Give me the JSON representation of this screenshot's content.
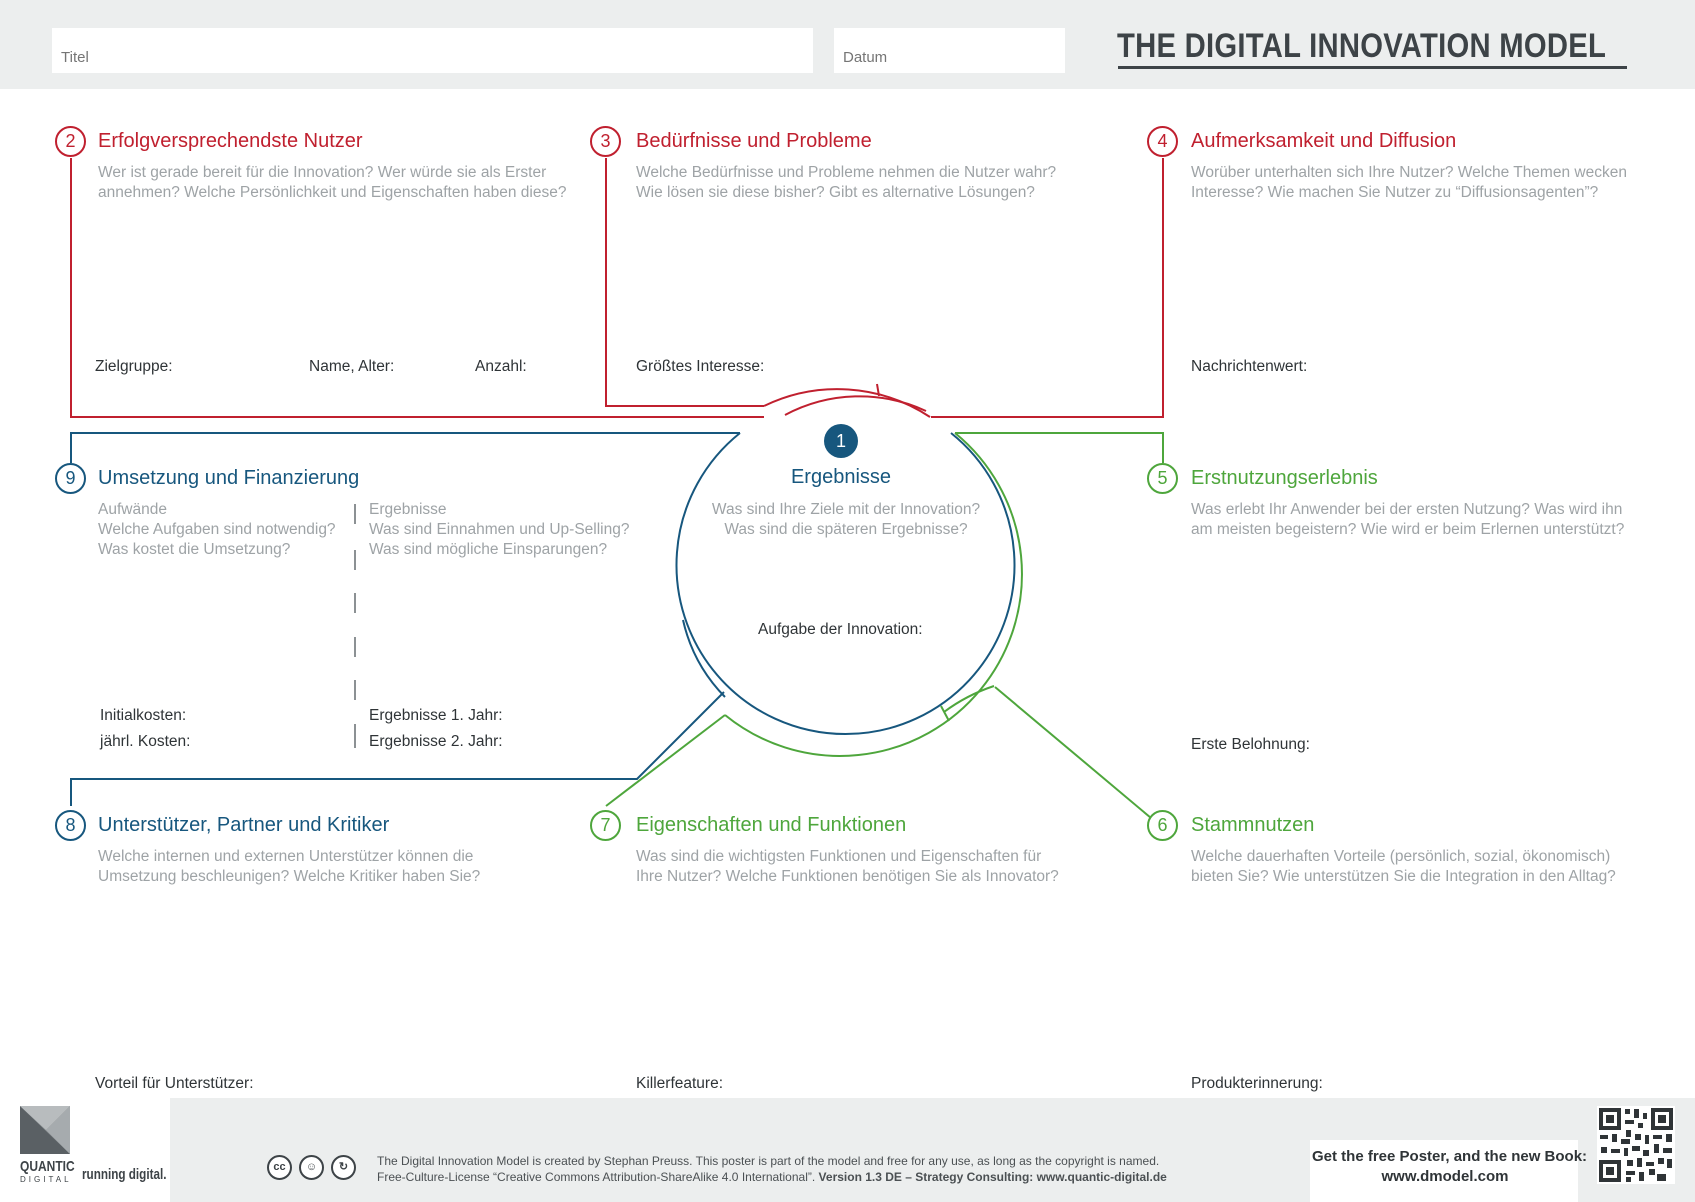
{
  "header": {
    "title_placeholder": "Titel",
    "date_placeholder": "Datum",
    "model_title": "THE DIGITAL INNOVATION MODEL"
  },
  "colors": {
    "red": "#c0202f",
    "blue": "#17577e",
    "green": "#4ea63c",
    "dark": "#3d4347",
    "grey_text": "#9ea3a6"
  },
  "center": {
    "number": "1",
    "title": "Ergebnisse",
    "question": "Was sind Ihre Ziele mit der Innovation?\nWas sind die späteren Ergebnisse?",
    "label": "Aufgabe der Innovation:"
  },
  "sections": {
    "s2": {
      "number": "2",
      "title": "Erfolgversprechendste Nutzer",
      "question": "Wer ist gerade bereit für die Innovation? Wer würde sie als Erster\nannehmen? Welche Persönlichkeit und Eigenschaften haben diese?",
      "labels": [
        "Zielgruppe:",
        "Name, Alter:",
        "Anzahl:"
      ]
    },
    "s3": {
      "number": "3",
      "title": "Bedürfnisse und Probleme",
      "question": "Welche Bedürfnisse und Probleme nehmen die Nutzer wahr?\nWie lösen sie diese bisher? Gibt es alternative Lösungen?",
      "labels": [
        "Größtes Interesse:"
      ]
    },
    "s4": {
      "number": "4",
      "title": "Aufmerksamkeit und Diffusion",
      "question": "Worüber unterhalten sich Ihre Nutzer? Welche Themen wecken\nInteresse? Wie machen Sie Nutzer zu “Diffusionsagenten”?",
      "labels": [
        "Nachrichtenwert:"
      ]
    },
    "s5": {
      "number": "5",
      "title": "Erstnutzungserlebnis",
      "question": "Was erlebt Ihr Anwender bei der ersten Nutzung? Was wird ihn\nam meisten begeistern? Wie wird er beim Erlernen unterstützt?",
      "labels": [
        "Erste Belohnung:"
      ]
    },
    "s6": {
      "number": "6",
      "title": "Stammnutzen",
      "question": "Welche dauerhaften Vorteile (persönlich, sozial, ökonomisch)\nbieten Sie? Wie unterstützen Sie die Integration in den Alltag?",
      "labels": [
        "Produkterinnerung:"
      ]
    },
    "s7": {
      "number": "7",
      "title": "Eigenschaften und Funktionen",
      "question": "Was sind die wichtigsten Funktionen und Eigenschaften für\nIhre Nutzer? Welche Funktionen benötigen Sie als Innovator?",
      "labels": [
        "Killerfeature:"
      ]
    },
    "s8": {
      "number": "8",
      "title": "Unterstützer, Partner und Kritiker",
      "question": "Welche internen und externen Unterstützer können die\nUmsetzung beschleunigen? Welche Kritiker haben Sie?",
      "labels": [
        "Vorteil für Unterstützer:"
      ]
    },
    "s9": {
      "number": "9",
      "title": "Umsetzung und Finanzierung",
      "left_title": "Aufwände",
      "left_question": "Welche Aufgaben sind notwendig?\nWas kostet die Umsetzung?",
      "right_title": "Ergebnisse",
      "right_question": "Was sind Einnahmen und Up-Selling?\nWas sind mögliche Einsparungen?",
      "left_labels": [
        "Initialkosten:",
        "jährl. Kosten:"
      ],
      "right_labels": [
        "Ergebnisse 1. Jahr:",
        "Ergebnisse 2. Jahr:"
      ]
    }
  },
  "footer": {
    "logo_name": "QUANTIC",
    "logo_sub": "DIGITAL",
    "slogan": "running digital.",
    "license_line1": "The Digital Innovation Model is created by Stephan Preuss. This poster is part of the model and free for any use, as long as the copyright is named.",
    "license_line2_a": "Free-Culture-License “Creative Commons Attribution-ShareAlike 4.0 International”.",
    "license_line2_b": "Version 1.3 DE  –  Strategy Consulting: www.quantic-digital.de",
    "cc_icons": [
      "cc-icon",
      "by-icon",
      "sa-icon"
    ],
    "get_line1": "Get the free Poster, and the new Book:",
    "get_line2": "www.dmodel.com"
  }
}
